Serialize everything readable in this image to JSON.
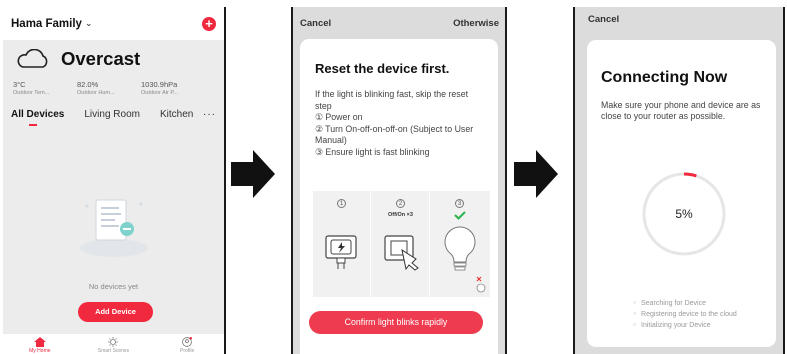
{
  "screen1": {
    "family": "Hama Family",
    "weather": "Overcast",
    "stats": [
      {
        "value": "3°C",
        "label": "Outdoor Tem..."
      },
      {
        "value": "82.0%",
        "label": "Outdoor Hum..."
      },
      {
        "value": "1030.9hPa",
        "label": "Outdoor Air P..."
      }
    ],
    "tabs": [
      "All Devices",
      "Living Room",
      "Kitchen"
    ],
    "more": "···",
    "empty_text": "No devices yet",
    "add_button": "Add Device",
    "nav": [
      "My Home",
      "Smart Scenes",
      "Profile"
    ]
  },
  "screen2": {
    "cancel": "Cancel",
    "otherwise": "Otherwise",
    "title": "Reset the device first.",
    "intro": "If the light is blinking fast, skip the reset step",
    "steps": [
      "① Power on",
      "② Turn On-off-on-off-on (Subject to User Manual)",
      "③ Ensure light is fast blinking"
    ],
    "diagram_numbers": [
      "1",
      "2",
      "3"
    ],
    "onoff_label": "Off/On ×3",
    "confirm_button": "Confirm light blinks rapidly"
  },
  "screen3": {
    "cancel": "Cancel",
    "title": "Connecting Now",
    "description": "Make sure your phone and device are as close to your router as possible.",
    "progress_text": "5%",
    "progress": 0.05,
    "status": [
      "Searching for Device",
      "Registering device to the cloud",
      "Initializing your Device"
    ]
  },
  "colors": {
    "accent": "#f0293f",
    "arrow": "#111111"
  }
}
